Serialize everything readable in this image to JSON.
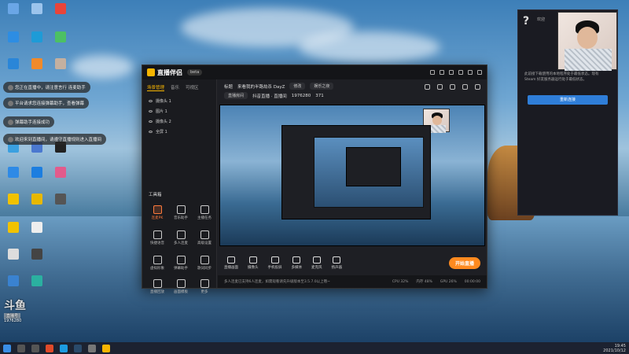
{
  "window": {
    "app_name": "直播伴侣",
    "version": "beta",
    "left_tabs": [
      "场景管理",
      "音乐",
      "可视区"
    ],
    "scenes": [
      "摄像头 1",
      "图片 1",
      "摄像头 2",
      "全屏 1"
    ],
    "tools_title": "工具箱",
    "tools": [
      {
        "label": "连麦PK"
      },
      {
        "label": "音乐助手"
      },
      {
        "label": "主播任务"
      },
      {
        "label": "快捷语音"
      },
      {
        "label": "多人连麦"
      },
      {
        "label": "高级设置"
      },
      {
        "label": "虚拟形象"
      },
      {
        "label": "弹幕助手"
      },
      {
        "label": "歌词同步"
      },
      {
        "label": "直播回放"
      },
      {
        "label": "画面模板"
      },
      {
        "label": "更多"
      }
    ],
    "header": {
      "title_label": "标题",
      "title_value": "来看我的半路劫杀 DayZ",
      "edit_label": "修改",
      "category": "娱乐之夜",
      "room_label": "直播房间",
      "room_value": "抖音直播 · 直播间",
      "room_number": "1976280",
      "viewers": "371"
    },
    "bottom_buttons": [
      "直播画面",
      "摄像头",
      "手机投屏",
      "多媒体",
      "麦克风",
      "扬声器"
    ],
    "go_live_label": "开始直播",
    "status_text": "多人连麦已支持6人连麦，如需观看请先升级版本至3.5.7.0以上哦~",
    "status_right": [
      "CPU 32%",
      "内存 48%",
      "GPU 26%",
      "00:00:00"
    ]
  },
  "right_panel": {
    "title": "欢迎",
    "body": "此前接下载使用的本地程序处于最低状态。现有 Steam 好友服务器运行处于最低状态。",
    "button": "重新连接"
  },
  "chats": [
    "您正在直播中，请注意言行 连麦助手",
    "平台请求您连接弹幕助手，查看弹幕",
    "弹幕助手连接成功",
    "欢迎来到直播间，请遵守直播规则进入直播间"
  ],
  "taskbar": {
    "time": "19:45",
    "date": "2021/10/12"
  },
  "watermark": {
    "logo": "斗鱼",
    "tag": "直播号",
    "room": "1976280"
  },
  "colors": {
    "accent": "#f7b500",
    "go_live": "#ff8a1f",
    "button_blue": "#2f7ed8"
  }
}
